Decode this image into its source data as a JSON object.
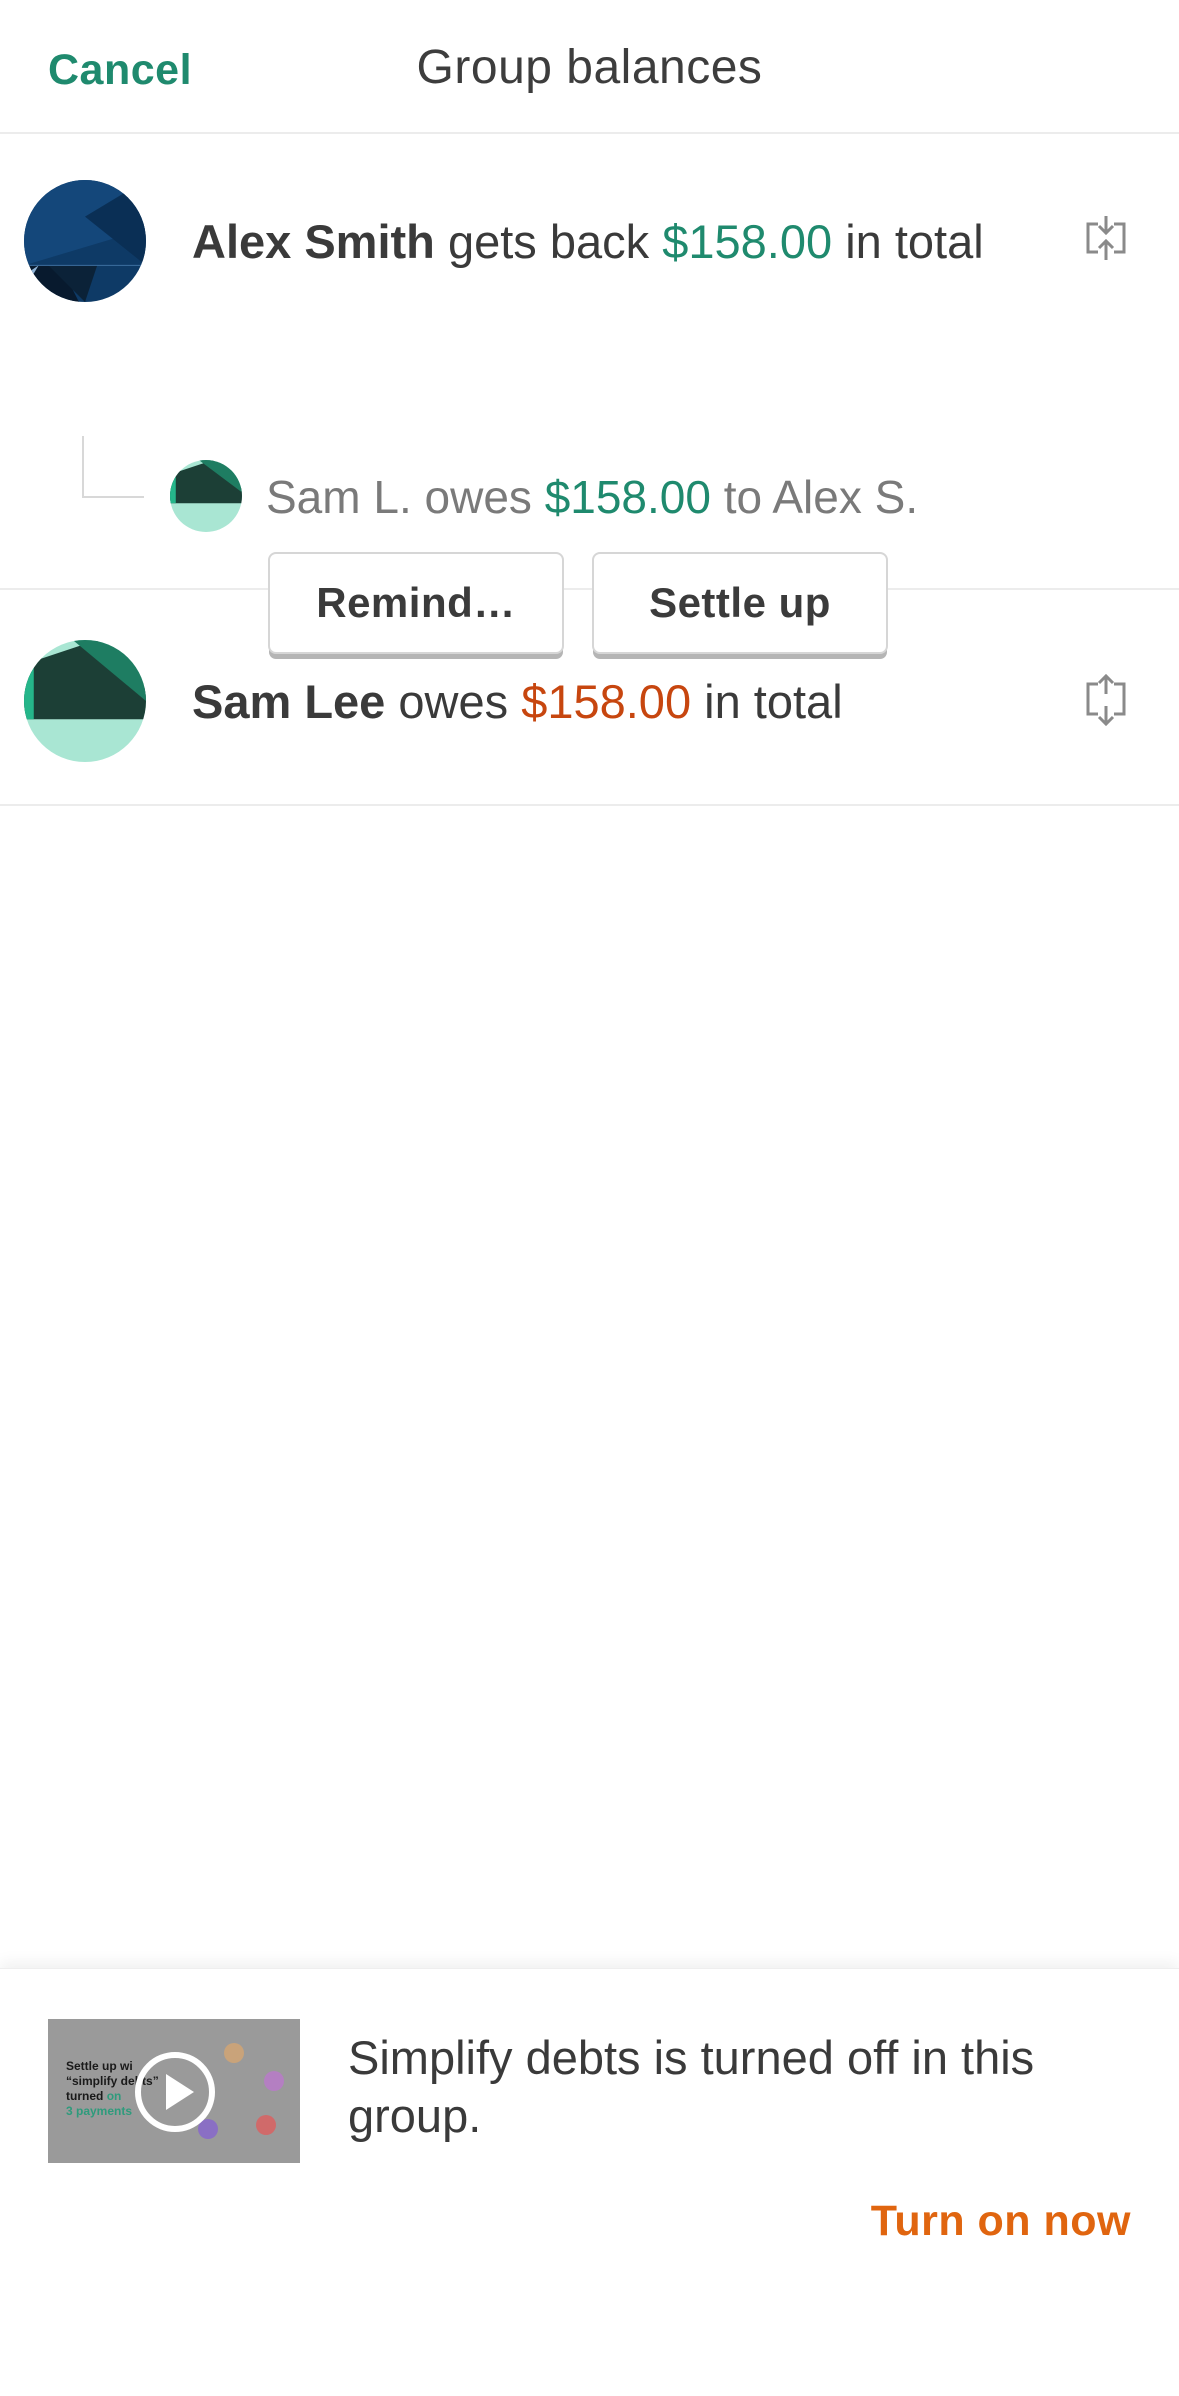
{
  "header": {
    "cancel_label": "Cancel",
    "title": "Group balances"
  },
  "balances": [
    {
      "name": "Alex Smith",
      "verb": "gets back",
      "amount": "$158.00",
      "suffix": "in total",
      "amount_color": "#1f8a6e",
      "details": [
        {
          "from": "Sam L.",
          "verb": "owes",
          "amount": "$158.00",
          "to_prefix": "to",
          "to": "Alex S."
        }
      ],
      "actions": {
        "remind_label": "Remind…",
        "settle_label": "Settle up"
      }
    },
    {
      "name": "Sam Lee",
      "verb": "owes",
      "amount": "$158.00",
      "suffix": "in total",
      "amount_color": "#c7460f"
    }
  ],
  "footer": {
    "video_thumb_text": {
      "line1": "Settle up wi",
      "line2": "“simplify de",
      "line2b": "bts”",
      "line3": "turned",
      "line3_green": "on",
      "line4_green": "3 payments"
    },
    "info_text": "Simplify debts is turned off in this group.",
    "turn_on_label": "Turn on now"
  },
  "colors": {
    "accent_green": "#1f8a6e",
    "owes_orange": "#c7460f",
    "turn_on_orange": "#e0650f"
  }
}
